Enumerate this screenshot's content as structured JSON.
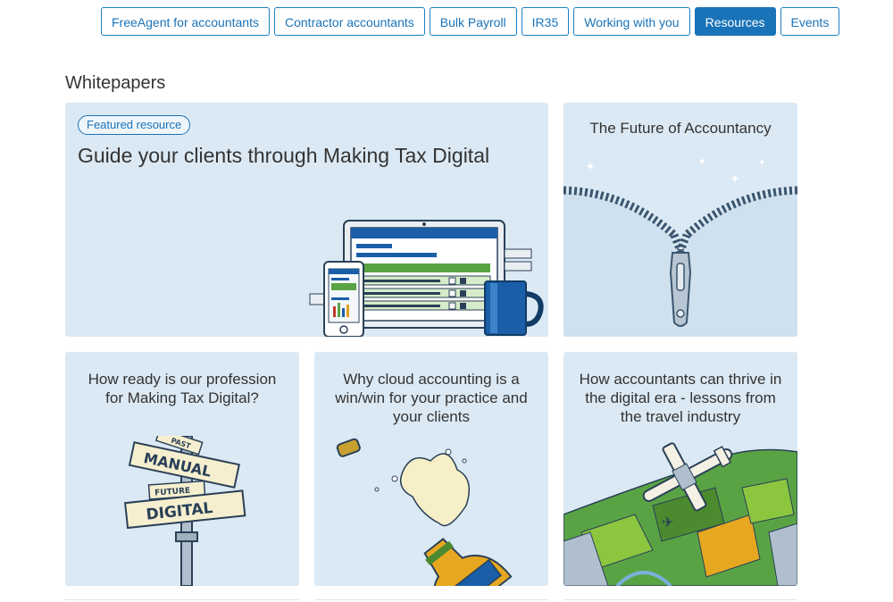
{
  "nav": {
    "items": [
      {
        "label": "FreeAgent for accountants",
        "active": false
      },
      {
        "label": "Contractor accountants",
        "active": false
      },
      {
        "label": "Bulk Payroll",
        "active": false
      },
      {
        "label": "IR35",
        "active": false
      },
      {
        "label": "Working with you",
        "active": false
      },
      {
        "label": "Resources",
        "active": true
      },
      {
        "label": "Events",
        "active": false
      }
    ]
  },
  "section": {
    "title": "Whitepapers"
  },
  "cards": {
    "featured": {
      "badge": "Featured resource",
      "title": "Guide your clients through Making Tax Digital",
      "illustration": "laptop-phone-mug-illustration"
    },
    "future": {
      "title": "The Future of Accountancy",
      "illustration": "zipper-illustration"
    },
    "ready": {
      "title": "How ready is our profession for Making Tax Digital?",
      "illustration": "signpost-illustration",
      "sign_past": "PAST",
      "sign_manual": "MANUAL",
      "sign_future": "FUTURE",
      "sign_digital": "DIGITAL"
    },
    "cloud": {
      "title": "Why cloud accounting is a win/win for your practice and your clients",
      "illustration": "champagne-illustration"
    },
    "thrive": {
      "title": "How accountants can thrive in the digital era - lessons from the travel industry",
      "illustration": "plane-landscape-illustration"
    }
  },
  "colors": {
    "accent": "#1a73b8",
    "card_bg": "#dbe9f4"
  }
}
